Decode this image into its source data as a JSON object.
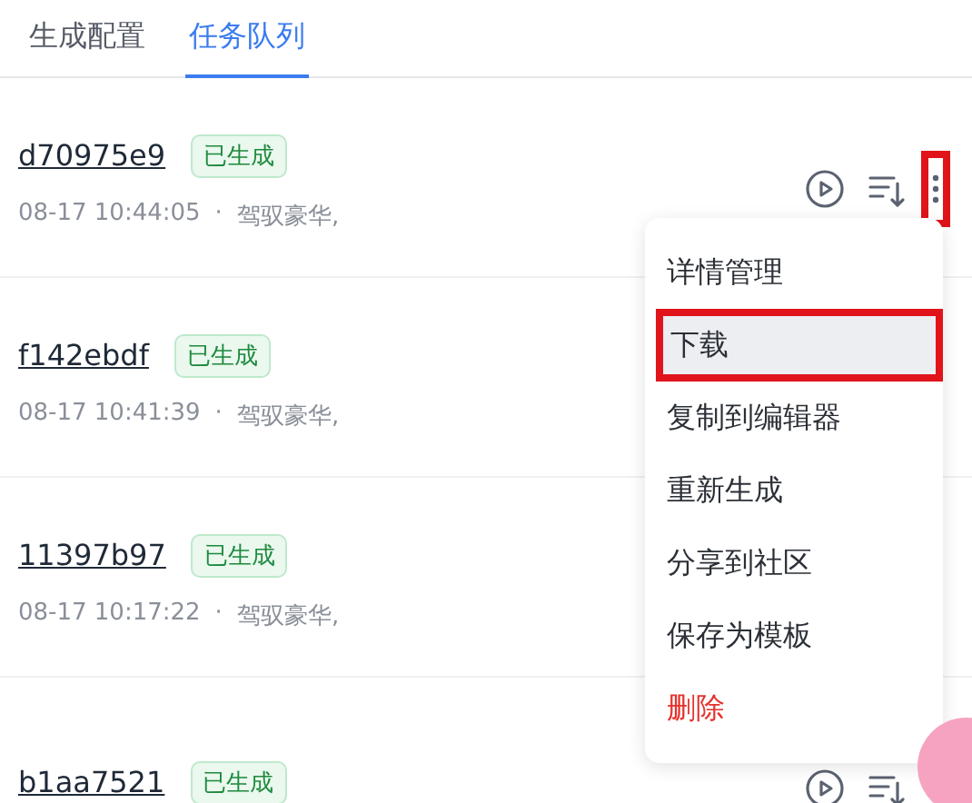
{
  "tabs": [
    {
      "label": "生成配置",
      "selected": false
    },
    {
      "label": "任务队列",
      "selected": true
    }
  ],
  "tasks": [
    {
      "id": "d70975e9",
      "status": "已生成",
      "time": "08-17 10:44:05",
      "separator": "·",
      "desc": "驾驭豪华,",
      "actions": {
        "more_highlighted": true
      }
    },
    {
      "id": "f142ebdf",
      "status": "已生成",
      "time": "08-17 10:41:39",
      "separator": "·",
      "desc": "驾驭豪华,"
    },
    {
      "id": "11397b97",
      "status": "已生成",
      "time": "08-17 10:17:22",
      "separator": "·",
      "desc": "驾驭豪华,"
    },
    {
      "id": "b1aa7521",
      "status": "已生成",
      "actions": {
        "more_highlighted": false
      }
    }
  ],
  "menu": [
    {
      "label": "详情管理",
      "kind": "normal",
      "hovered": false,
      "highlighted": false
    },
    {
      "label": "下载",
      "kind": "normal",
      "hovered": true,
      "highlighted": true
    },
    {
      "label": "复制到编辑器",
      "kind": "normal",
      "hovered": false,
      "highlighted": false
    },
    {
      "label": "重新生成",
      "kind": "normal",
      "hovered": false,
      "highlighted": false
    },
    {
      "label": "分享到社区",
      "kind": "normal",
      "hovered": false,
      "highlighted": false
    },
    {
      "label": "保存为模板",
      "kind": "normal",
      "hovered": false,
      "highlighted": false
    },
    {
      "label": "删除",
      "kind": "danger",
      "hovered": false,
      "highlighted": false
    }
  ]
}
